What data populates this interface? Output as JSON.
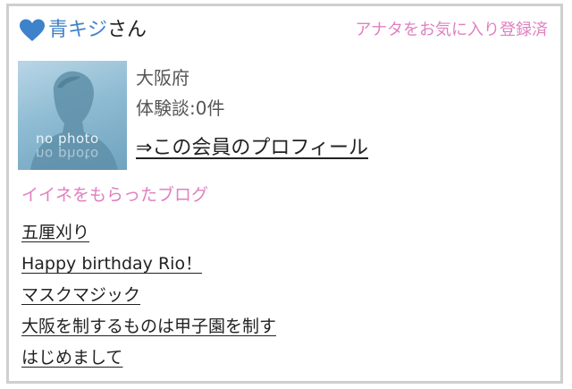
{
  "member": {
    "username": "青キジ",
    "honorific": "さん",
    "favorite_status": "アナタをお気に入り登録済",
    "prefecture": "大阪府",
    "stories_label": "体験談:0件",
    "avatar_text": "no photo",
    "profile_link": "⇒この会員のプロフィール"
  },
  "liked_blogs": {
    "title": "イイネをもらったブログ",
    "items": [
      "五厘刈り",
      "Happy birthday Rio！",
      "マスクマジック",
      "大阪を制するものは甲子園を制す",
      "はじめまして"
    ]
  },
  "colors": {
    "heart": "#3e82c9",
    "username": "#3e82c9",
    "accent_pink": "#e07fc1",
    "border": "#cfcfcf"
  },
  "icons": {
    "heart": "heart-icon",
    "avatar": "no-photo-silhouette"
  }
}
